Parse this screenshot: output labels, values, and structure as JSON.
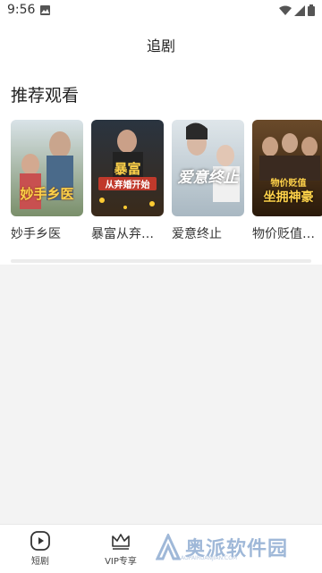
{
  "status_bar": {
    "time": "9:56"
  },
  "header": {
    "title": "追剧"
  },
  "section": {
    "title": "推荐观看"
  },
  "cards": [
    {
      "title": "妙手乡医",
      "poster_text": "妙手乡医"
    },
    {
      "title": "暴富从弃…",
      "poster_text_line1": "暴富",
      "poster_text_line2": "从弃婚开始"
    },
    {
      "title": "爱意终止",
      "poster_text": "爱意终止"
    },
    {
      "title": "物价贬值…",
      "poster_text_line1": "物价贬值",
      "poster_text_line2": "坐拥神豪"
    }
  ],
  "bottom_nav": {
    "short_drama": "短剧",
    "vip": "VIP专享"
  },
  "watermark": {
    "text": "奥派软件园",
    "sub": "AOPAIRUANJIAN.COM"
  },
  "colors": {
    "accent": "#f5c542",
    "background": "#f3f3f3"
  }
}
